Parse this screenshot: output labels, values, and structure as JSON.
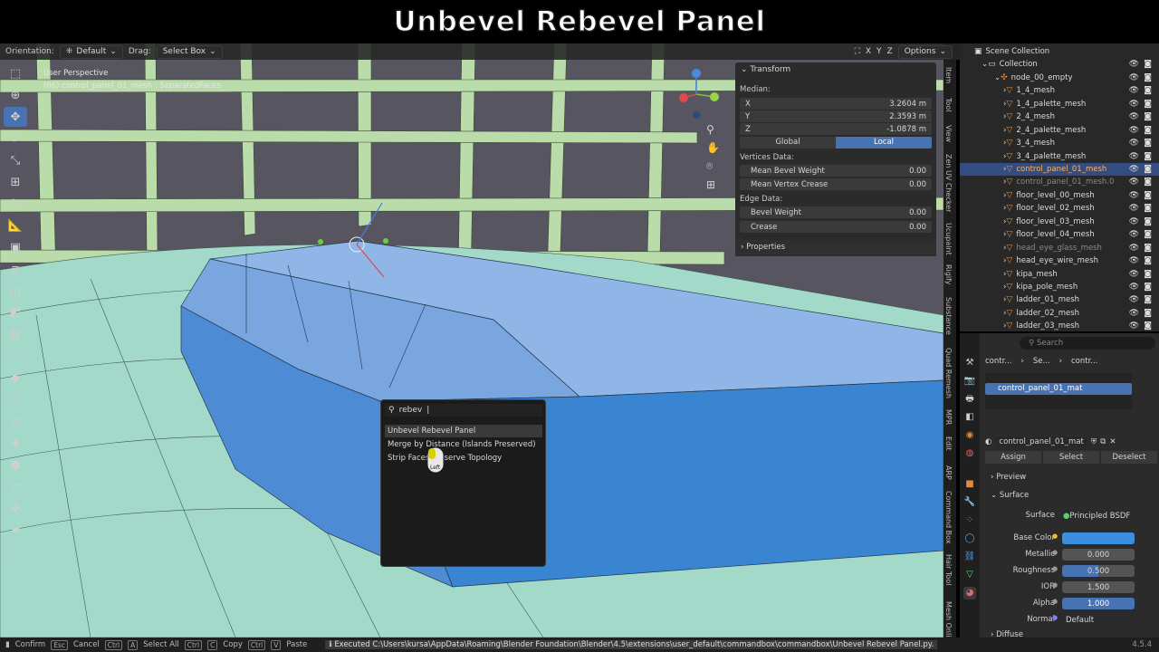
{
  "video_title": "Unbevel Rebevel Panel",
  "header": {
    "orientation_label": "Orientation:",
    "orientation_value": "Default",
    "drag_label": "Drag:",
    "drag_value": "Select Box",
    "axes": [
      "X",
      "Y",
      "Z"
    ],
    "options_label": "Options"
  },
  "viewport": {
    "perspective": "User Perspective",
    "object_info": "(66) control_panel_01_mesh : SeparatedFaces"
  },
  "transform_panel": {
    "title": "Transform",
    "median_label": "Median:",
    "x_label": "X",
    "x_value": "3.2604 m",
    "y_label": "Y",
    "y_value": "2.3593 m",
    "z_label": "Z",
    "z_value": "-1.0878 m",
    "global_label": "Global",
    "local_label": "Local",
    "vertices_data_label": "Vertices Data:",
    "mean_bevel_weight_label": "Mean Bevel Weight",
    "mean_bevel_weight_value": "0.00",
    "mean_vertex_crease_label": "Mean Vertex Crease",
    "mean_vertex_crease_value": "0.00",
    "edge_data_label": "Edge Data:",
    "bevel_weight_label": "Bevel Weight",
    "bevel_weight_value": "0.00",
    "crease_label": "Crease",
    "crease_value": "0.00",
    "properties_label": "Properties"
  },
  "side_tabs": [
    "Item",
    "Tool",
    "View",
    "Zen UV Checker",
    "Ucupaint",
    "Rigify",
    "Substance",
    "Quad Remesh",
    "MPR",
    "Edit",
    "ARP",
    "Command Box",
    "Hair Tool",
    "Mesh Onli"
  ],
  "outliner": {
    "scene_collection": "Scene Collection",
    "collection": "Collection",
    "root": "node_00_empty",
    "items": [
      "1_4_mesh",
      "1_4_palette_mesh",
      "2_4_mesh",
      "2_4_palette_mesh",
      "3_4_mesh",
      "3_4_palette_mesh",
      "control_panel_01_mesh",
      "control_panel_01_mesh.0",
      "floor_level_00_mesh",
      "floor_level_02_mesh",
      "floor_level_03_mesh",
      "floor_level_04_mesh",
      "head_eye_glass_mesh",
      "head_eye_wire_mesh",
      "kipa_mesh",
      "kipa_pole_mesh",
      "ladder_01_mesh",
      "ladder_02_mesh",
      "ladder_03_mesh"
    ]
  },
  "properties": {
    "search_placeholder": "Search",
    "breadcrumb": [
      "contr...",
      "Se...",
      "contr..."
    ],
    "material_slot": "control_panel_01_mat",
    "material_name": "control_panel_01_mat",
    "assign_label": "Assign",
    "select_label": "Select",
    "deselect_label": "Deselect",
    "preview_label": "Preview",
    "surface_section": "Surface",
    "surface_label": "Surface",
    "surface_value": "Principled BSDF",
    "base_color_label": "Base Color",
    "base_color": "#3d8ee0",
    "metallic_label": "Metallic",
    "metallic_value": "0.000",
    "roughness_label": "Roughness",
    "roughness_value": "0.500",
    "ior_label": "IOR",
    "ior_value": "1.500",
    "alpha_label": "Alpha",
    "alpha_value": "1.000",
    "normal_label": "Normal",
    "normal_value": "Default",
    "diffuse_label": "Diffuse"
  },
  "search_popup": {
    "query": "rebev",
    "results": [
      "Unbevel Rebevel Panel",
      "Merge by Distance (Islands Preserved)",
      "Strip Faces Preserve Topology"
    ],
    "cursor_label": "Left"
  },
  "statusbar": {
    "confirm": "Confirm",
    "cancel": "Cancel",
    "select_all": "Select All",
    "copy": "Copy",
    "paste": "Paste",
    "keys": [
      "Esc",
      "Ctrl",
      "A",
      "Ctrl",
      "C",
      "Ctrl",
      "V"
    ],
    "message": "Executed C:\\Users\\kursa\\AppData\\Roaming\\Blender Foundation\\Blender\\4.5\\extensions\\user_default\\commandbox\\commandbox\\Unbevel Rebevel Panel.py.",
    "version": "4.5.4"
  },
  "colors": {
    "accent": "#4772b3",
    "mesh_blue": "#4a84cc",
    "wire_green": "#b8e0a8",
    "floor_teal": "#9cd6c4"
  }
}
